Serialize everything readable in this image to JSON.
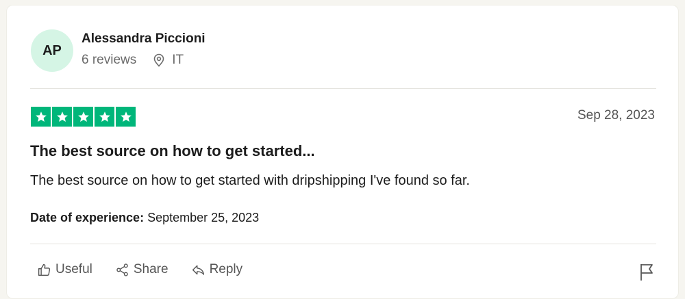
{
  "reviewer": {
    "initials": "AP",
    "name": "Alessandra Piccioni",
    "reviews_count": "6 reviews",
    "country": "IT"
  },
  "review": {
    "rating": 5,
    "date": "Sep 28, 2023",
    "title": "The best source on how to get started...",
    "body": "The best source on how to get started with dripshipping I've found so far.",
    "experience_label": "Date of experience:",
    "experience_date": "September 25, 2023"
  },
  "actions": {
    "useful": "Useful",
    "share": "Share",
    "reply": "Reply"
  },
  "icons": {
    "location": "location-pin-icon",
    "useful": "thumbs-up-icon",
    "share": "share-icon",
    "reply": "reply-icon",
    "report": "flag-icon",
    "star": "star-icon"
  },
  "colors": {
    "star_green": "#00b67a",
    "avatar_bg": "#d5f5e5"
  }
}
